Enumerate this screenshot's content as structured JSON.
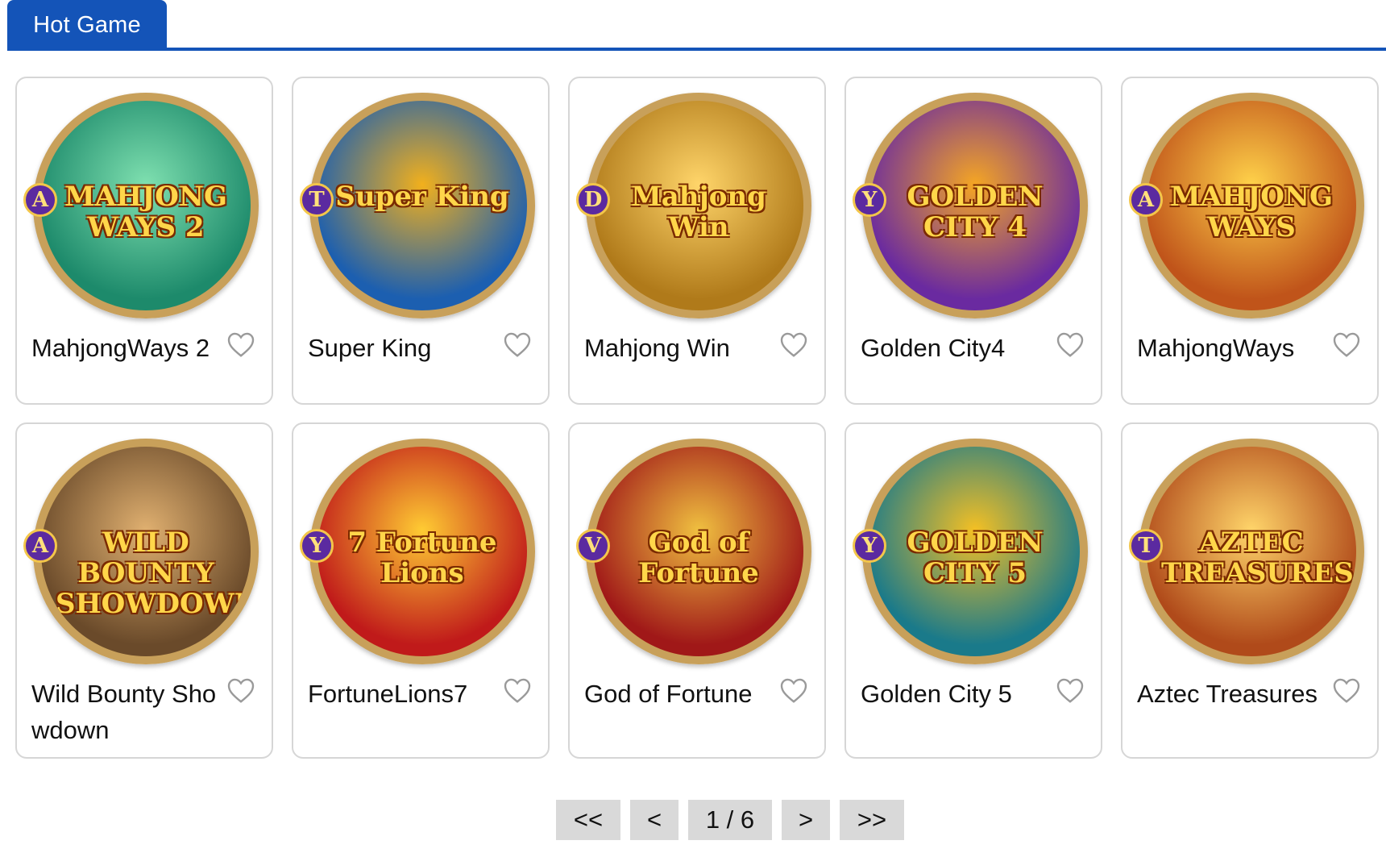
{
  "tab": {
    "label": "Hot Game"
  },
  "games": [
    {
      "name": "MahjongWays 2",
      "art_title": "MAHJONG WAYS 2",
      "provider": "A",
      "bg": "#1d8a6b",
      "bg2": "#7fe0b0"
    },
    {
      "name": "Super King",
      "art_title": "Super King",
      "provider": "T",
      "bg": "#1c5fb0",
      "bg2": "#f2b01c"
    },
    {
      "name": "Mahjong Win",
      "art_title": "Mahjong Win",
      "provider": "D",
      "bg": "#b07a1a",
      "bg2": "#ffd56a"
    },
    {
      "name": "Golden City4",
      "art_title": "GOLDEN CITY 4",
      "provider": "Y",
      "bg": "#6a2aa0",
      "bg2": "#f5a623"
    },
    {
      "name": "MahjongWays",
      "art_title": "MAHJONG WAYS",
      "provider": "A",
      "bg": "#c0541a",
      "bg2": "#ffd24a"
    },
    {
      "name": "Wild Bounty Showdown",
      "art_title": "WILD BOUNTY SHOWDOWN",
      "provider": "A",
      "bg": "#6a4a2a",
      "bg2": "#e0b070"
    },
    {
      "name": "FortuneLions7",
      "art_title": "7 Fortune Lions",
      "provider": "Y",
      "bg": "#c01a1a",
      "bg2": "#ffcc33"
    },
    {
      "name": "God of Fortune",
      "art_title": "God of Fortune",
      "provider": "V",
      "bg": "#a01818",
      "bg2": "#f0c040"
    },
    {
      "name": "Golden City 5",
      "art_title": "GOLDEN CITY 5",
      "provider": "Y",
      "bg": "#1a7a8a",
      "bg2": "#f5c023"
    },
    {
      "name": "Aztec Treasures",
      "art_title": "AZTEC TREASURES",
      "provider": "T",
      "bg": "#b04a1a",
      "bg2": "#ffd56a"
    }
  ],
  "pagination": {
    "first": "<<",
    "prev": "<",
    "current": "1 / 6",
    "next": ">",
    "last": ">>"
  }
}
